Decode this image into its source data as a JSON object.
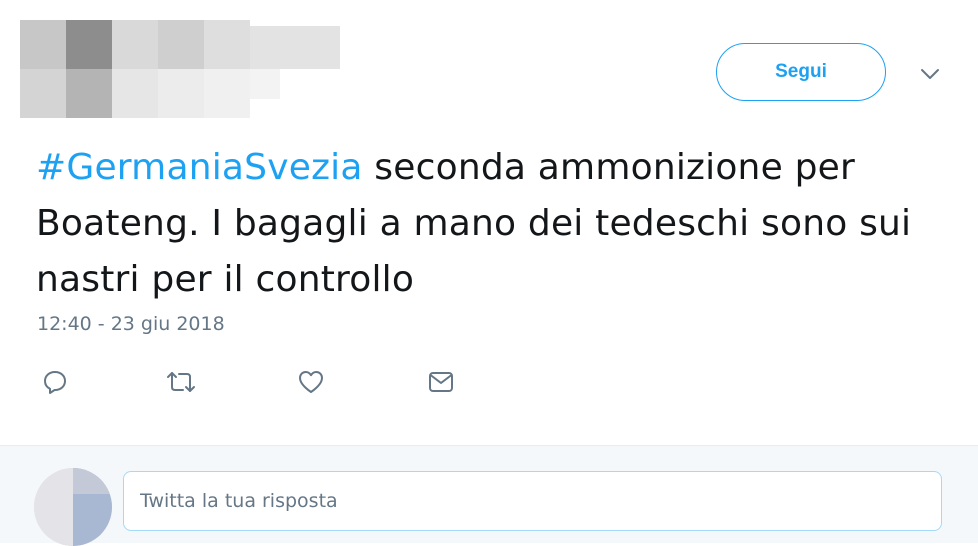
{
  "header": {
    "follow_label": "Segui"
  },
  "tweet": {
    "hashtag": "#GermaniaSvezia",
    "text_rest": " seconda ammonizione per Boateng. I bagagli a mano dei tedeschi sono sui nastri per il controllo",
    "timestamp": "12:40 - 23 giu 2018"
  },
  "actions": [
    {
      "icon": "reply-icon"
    },
    {
      "icon": "retweet-icon"
    },
    {
      "icon": "like-icon"
    },
    {
      "icon": "direct-message-icon"
    }
  ],
  "reply": {
    "placeholder": "Twitta la tua risposta"
  },
  "colors": {
    "accent": "#1da1f2",
    "text": "#14171a",
    "muted": "#657786",
    "reply_bg": "#f5f8fa"
  }
}
